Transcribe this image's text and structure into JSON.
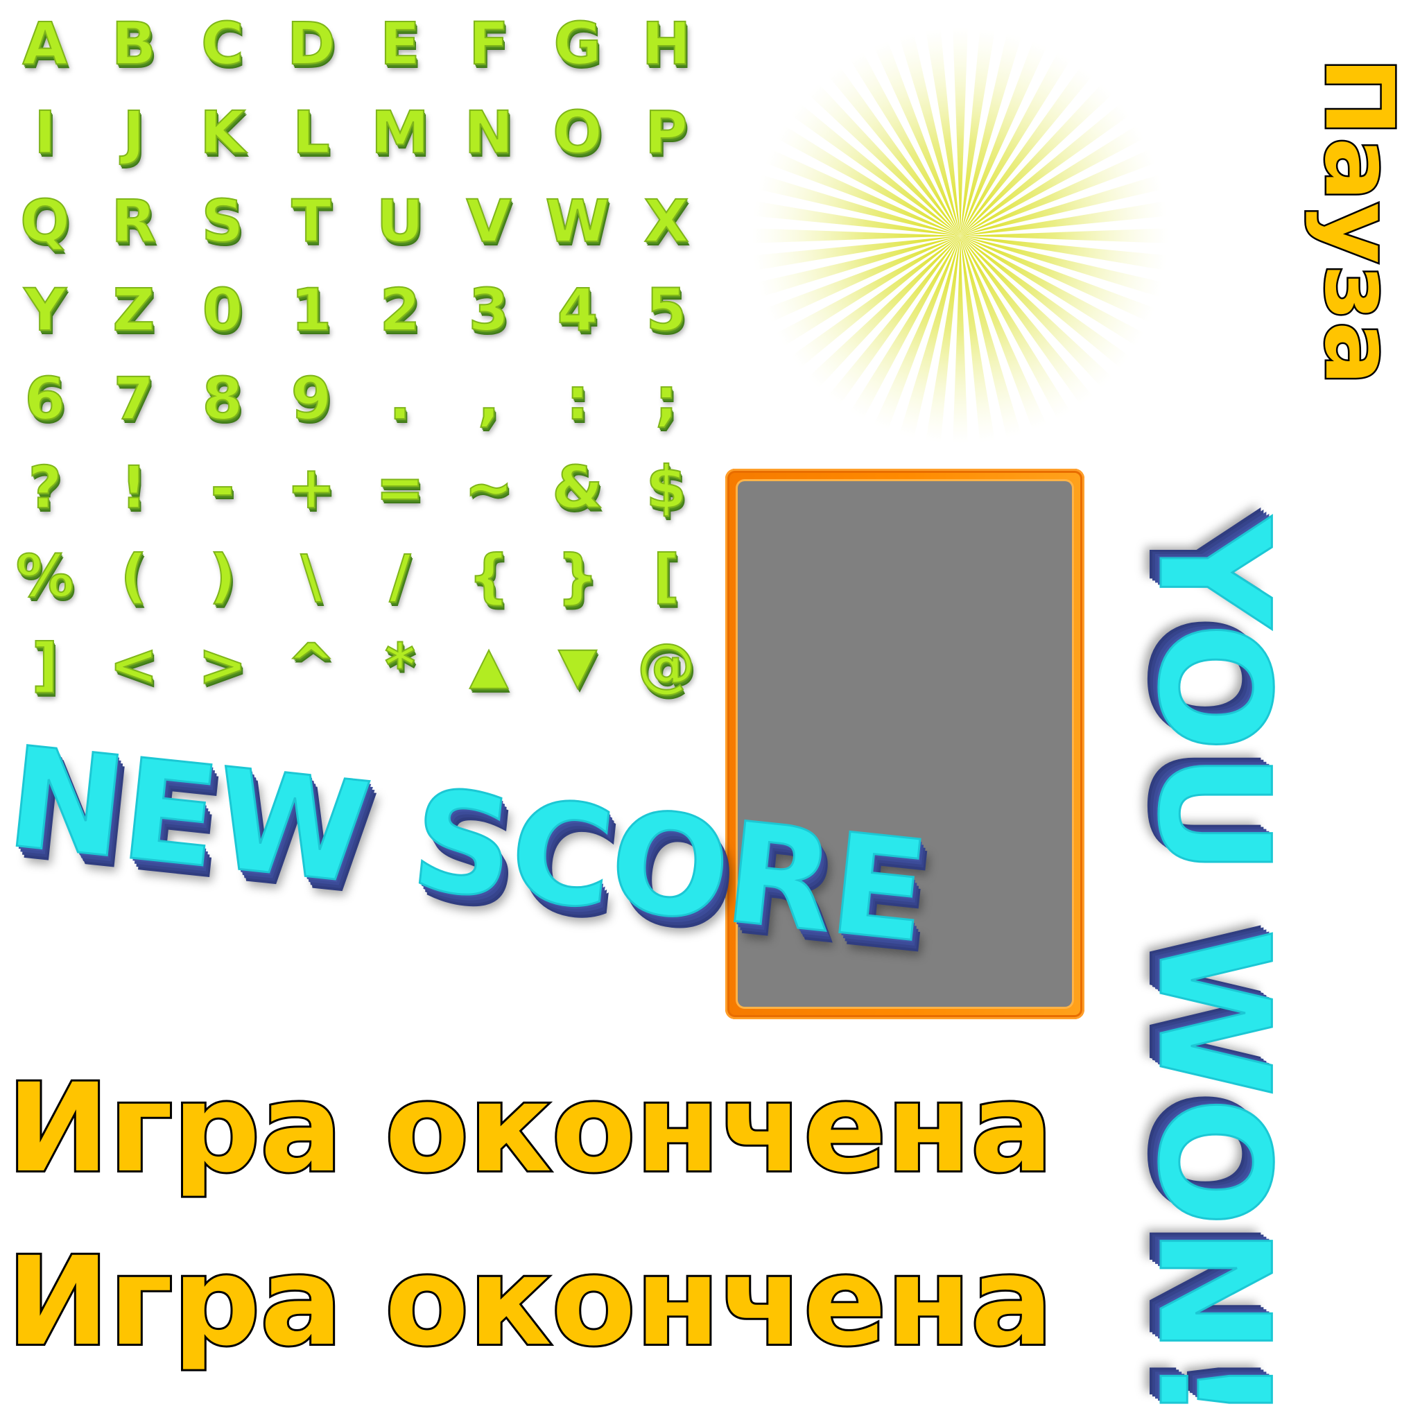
{
  "atlas": {
    "glyph_rows": [
      [
        "A",
        "B",
        "C",
        "D",
        "E",
        "F",
        "G",
        "H"
      ],
      [
        "I",
        "J",
        "K",
        "L",
        "M",
        "N",
        "O",
        "P"
      ],
      [
        "Q",
        "R",
        "S",
        "T",
        "U",
        "V",
        "W",
        "X"
      ],
      [
        "Y",
        "Z",
        "0",
        "1",
        "2",
        "3",
        "4",
        "5"
      ],
      [
        "6",
        "7",
        "8",
        "9",
        ".",
        ",",
        ":",
        ";"
      ],
      [
        "?",
        "!",
        "-",
        "+",
        "=",
        "~",
        "&",
        "$"
      ],
      [
        "%",
        "(",
        ")",
        "\\",
        "/",
        "{",
        "}",
        "["
      ],
      [
        "]",
        "<",
        ">",
        "^",
        "*",
        "▲",
        "▼",
        "@"
      ]
    ],
    "new_score_label": "NEW SCORE",
    "you_won_label": "YOU WON!",
    "pause_label": "Пауза",
    "game_over_lines": [
      "Игра окончена",
      "Игра окончена"
    ],
    "panel": {
      "frame_color": "#ff8a00",
      "inner_color": "#808080"
    },
    "colors": {
      "glyph_fill": "#b2ec22",
      "glyph_shadow": "#4f8b1d",
      "headline_fill": "#2ae8ec",
      "headline_shadow": "#3c4c99",
      "label_fill": "#ffc400",
      "label_outline": "#000000",
      "sunburst": "#e4ea6a"
    },
    "sunburst_icon": "sunburst-rays"
  }
}
